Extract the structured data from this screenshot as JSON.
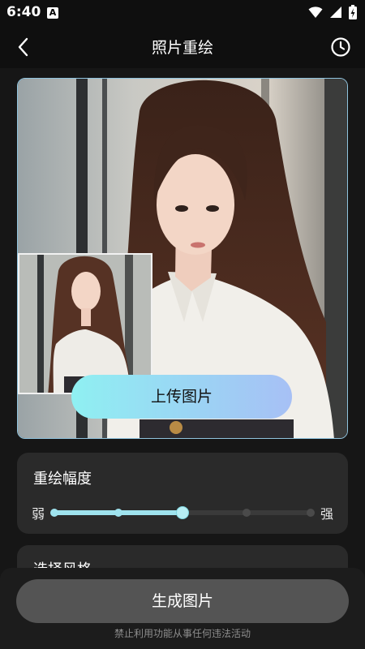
{
  "status_bar": {
    "time": "6:40",
    "notification_icon": "a-badge-icon",
    "icons": [
      "wifi-icon",
      "cellular-signal-icon",
      "battery-charging-icon"
    ]
  },
  "app_bar": {
    "title": "照片重绘",
    "back_icon": "chevron-left-icon",
    "history_icon": "clock-icon"
  },
  "preview": {
    "upload_label": "上传图片",
    "accent_border": "#8fc3de"
  },
  "strength": {
    "title": "重绘幅度",
    "weak_label": "弱",
    "strong_label": "强",
    "levels": 5,
    "selected_level": 3,
    "accent": "#9fe3ee"
  },
  "style": {
    "title": "选择风格"
  },
  "bottom": {
    "generate_label": "生成图片",
    "disclaimer": "禁止利用功能从事任何违法活动"
  }
}
